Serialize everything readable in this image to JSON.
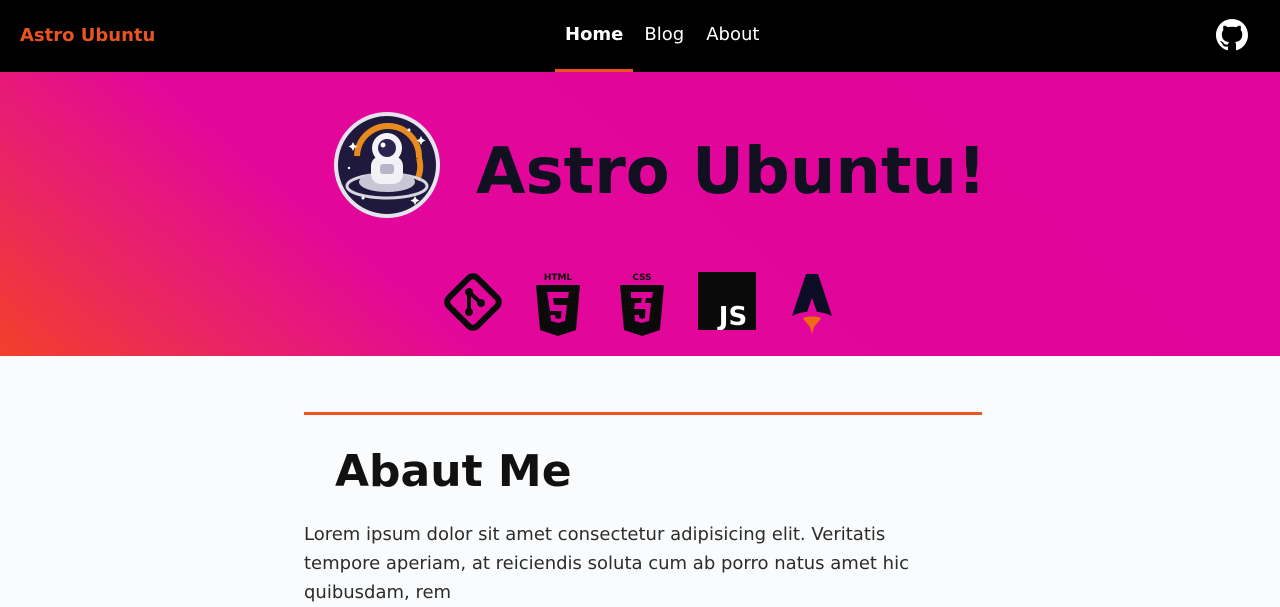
{
  "nav": {
    "brand": "Astro Ubuntu",
    "links": [
      {
        "label": "Home",
        "active": true
      },
      {
        "label": "Blog",
        "active": false
      },
      {
        "label": "About",
        "active": false
      }
    ],
    "github_icon": "github-icon"
  },
  "hero": {
    "title": "Astro Ubuntu!",
    "logo_icon": "astronaut-logo",
    "tech_icons": [
      "git-icon",
      "html5-icon",
      "css3-icon",
      "javascript-icon",
      "astro-icon"
    ],
    "html_label": "HTML",
    "css_label": "CSS",
    "js_label": "JS"
  },
  "about": {
    "title": "Abaut Me",
    "text": "Lorem ipsum dolor sit amet consectetur adipisicing elit. Veritatis tempore aperiam, at reiciendis soluta cum ab porro natus amet hic quibusdam, rem"
  },
  "colors": {
    "accent": "#e95420",
    "navbar": "#000000",
    "hero_pink": "#e0039c",
    "hero_orange": "#f2402a"
  }
}
